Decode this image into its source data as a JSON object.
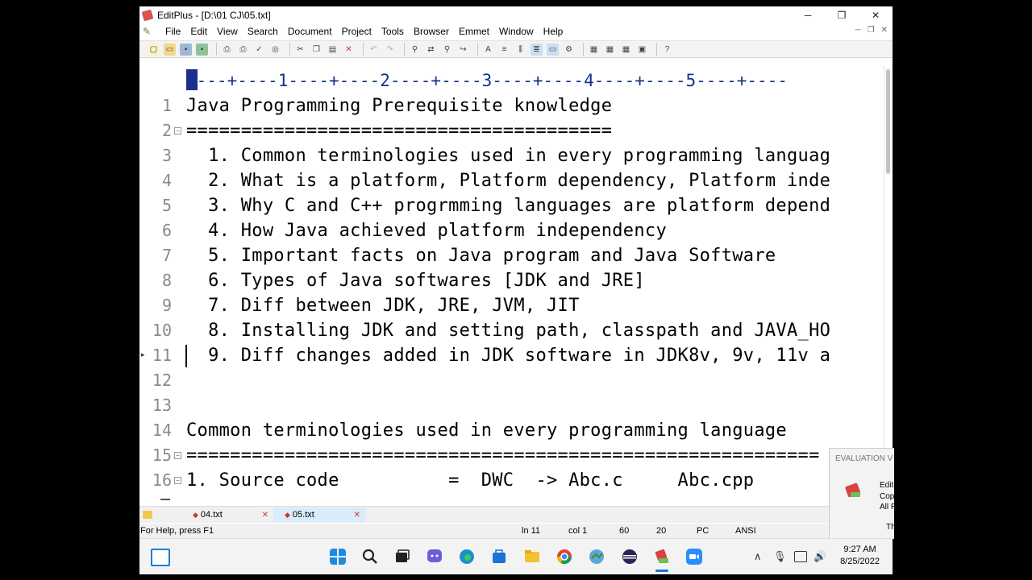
{
  "window": {
    "title": "EditPlus - [D:\\01 CJ\\05.txt]"
  },
  "window_controls": {
    "minimize": "─",
    "maximize": "❐",
    "close": "✕"
  },
  "menu": [
    "File",
    "Edit",
    "View",
    "Search",
    "Document",
    "Project",
    "Tools",
    "Browser",
    "Emmet",
    "Window",
    "Help"
  ],
  "ruler": "----+----1----+----2----+----3----+----4----+----5----+----",
  "editor": {
    "lines": [
      {
        "num": "1",
        "text": "Java Programming Prerequisite knowledge"
      },
      {
        "num": "2",
        "text": "======================================="
      },
      {
        "num": "3",
        "text": "  1. Common terminologies used in every programming languag"
      },
      {
        "num": "4",
        "text": "  2. What is a platform, Platform dependency, Platform inde"
      },
      {
        "num": "5",
        "text": "  3. Why C and C++ progrmming languages are platform depend"
      },
      {
        "num": "6",
        "text": "  4. How Java achieved platform independency"
      },
      {
        "num": "7",
        "text": "  5. Important facts on Java program and Java Software"
      },
      {
        "num": "8",
        "text": "  6. Types of Java softwares [JDK and JRE]"
      },
      {
        "num": "9",
        "text": "  7. Diff between JDK, JRE, JVM, JIT"
      },
      {
        "num": "10",
        "text": "  8. Installing JDK and setting path, classpath and JAVA_HO"
      },
      {
        "num": "11",
        "text": "  9. Diff changes added in JDK software in JDK8v, 9v, 11v a"
      },
      {
        "num": "12",
        "text": ""
      },
      {
        "num": "13",
        "text": ""
      },
      {
        "num": "14",
        "text": "Common terminologies used in every programming language"
      },
      {
        "num": "15",
        "text": "=========================================================="
      },
      {
        "num": "16",
        "text": "1. Source code          =  DWC  -> Abc.c     Abc.cpp"
      }
    ]
  },
  "tabs": [
    {
      "label": "04.txt",
      "active": false
    },
    {
      "label": "05.txt",
      "active": true
    }
  ],
  "status": {
    "help": "For Help, press F1",
    "line": "ln 11",
    "col": "col 1",
    "total": "60",
    "chars": "20",
    "mode": "PC",
    "encoding": "ANSI"
  },
  "evaluation": {
    "title": "EVALUATION V",
    "lines": [
      "Edit",
      "Cop",
      "All R",
      "Th"
    ]
  },
  "clock": {
    "time": "9:27 AM",
    "date": "8/25/2022"
  },
  "tray": {
    "up_arrow": "∧",
    "mic": "🎙",
    "volume": "🔊"
  },
  "colors": {
    "ruler": "#17318c",
    "tab_active": "#d9ecfb",
    "taskbar": "#f3f3f3"
  }
}
